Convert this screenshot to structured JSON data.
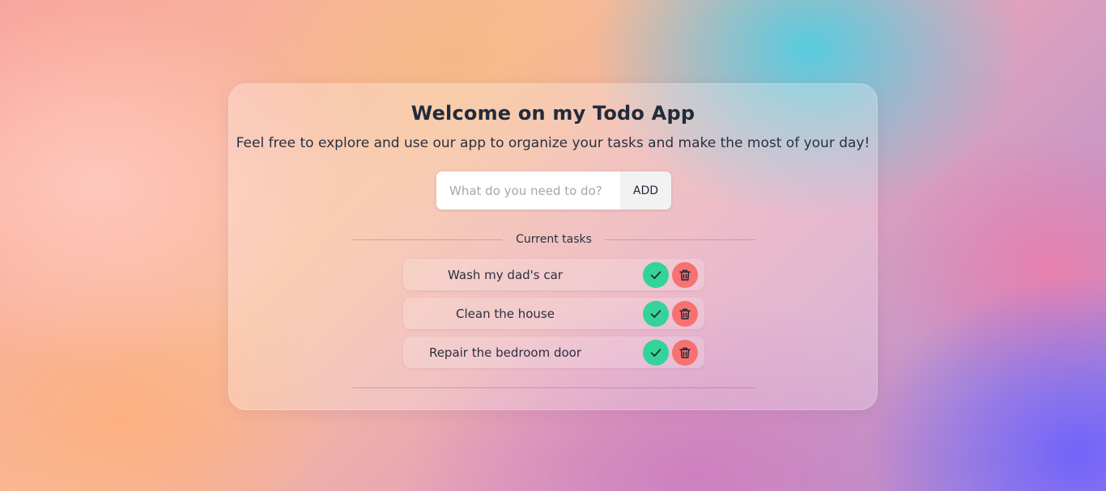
{
  "app": {
    "title": "Welcome on my Todo App",
    "subtitle": "Feel free to explore and use our app to organize your tasks and make the most of your day!"
  },
  "form": {
    "input_value": "",
    "input_placeholder": "What do you need to do?",
    "add_label": "ADD"
  },
  "tasks_section": {
    "label": "Current tasks"
  },
  "tasks": [
    {
      "text": "Wash my dad's car"
    },
    {
      "text": "Clean the house"
    },
    {
      "text": "Repair the bedroom door"
    }
  ],
  "icons": {
    "complete": "check-icon",
    "delete": "trash-icon"
  },
  "colors": {
    "complete_button": "#34d399",
    "delete_button": "#f87171",
    "text_primary": "#222b3a"
  }
}
